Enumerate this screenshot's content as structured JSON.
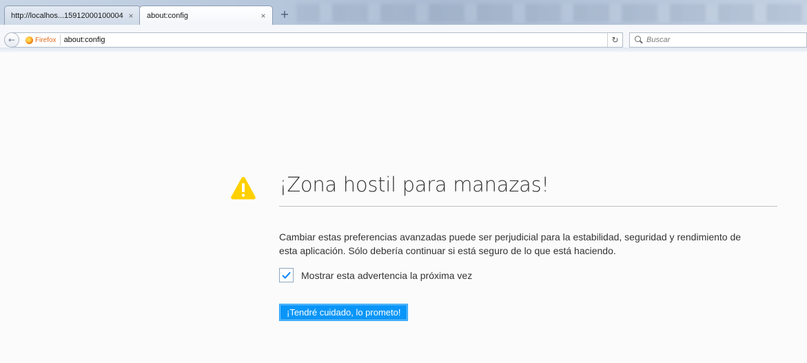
{
  "tabs": [
    {
      "title": "http://localhos...15912000100004",
      "close": "×"
    },
    {
      "title": "about:config",
      "close": "×"
    }
  ],
  "new_tab": "+",
  "navbar": {
    "back": "←",
    "identity_label": "Firefox",
    "url": "about:config",
    "reload": "C",
    "search_placeholder": "Buscar"
  },
  "page": {
    "title": "¡Zona hostil para manazas!",
    "description": "Cambiar estas preferencias avanzadas puede ser perjudicial para la estabilidad, seguridad y rendimiento de esta aplicación. Sólo debería continuar si está seguro de lo que está haciendo.",
    "checkbox_label": "Mostrar esta advertencia la próxima vez",
    "checkbox_checked": true,
    "button_label": "¡Tendré cuidado, lo prometo!"
  },
  "colors": {
    "accent_button": "#0996f8",
    "warning_yellow": "#ffd000",
    "checkmark": "#0a84ff"
  }
}
